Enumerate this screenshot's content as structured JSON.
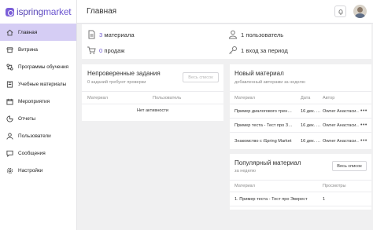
{
  "app": {
    "logo_prefix": "ispring",
    "logo_suffix": "market"
  },
  "header": {
    "title": "Главная"
  },
  "sidebar": {
    "items": [
      {
        "label": "Главная",
        "icon": "home-icon"
      },
      {
        "label": "Витрина",
        "icon": "storefront-icon"
      },
      {
        "label": "Программы обучения",
        "icon": "path-icon"
      },
      {
        "label": "Учебные материалы",
        "icon": "book-icon"
      },
      {
        "label": "Мероприятия",
        "icon": "calendar-icon"
      },
      {
        "label": "Отчеты",
        "icon": "report-icon"
      },
      {
        "label": "Пользователи",
        "icon": "users-icon"
      },
      {
        "label": "Сообщения",
        "icon": "message-icon"
      },
      {
        "label": "Настройки",
        "icon": "gear-icon"
      }
    ]
  },
  "stats": {
    "materials": {
      "num": "3",
      "text": "материала"
    },
    "sales": {
      "num": "0",
      "text": "продаж"
    },
    "users": {
      "text": "1 пользователь"
    },
    "logins": {
      "text": "1 вход за период"
    }
  },
  "unchecked": {
    "title": "Непроверенные задания",
    "subtitle": "0 заданий требуют проверки",
    "button": "Весь список",
    "columns": [
      "Материал",
      "Пользователь"
    ],
    "empty": "Нет активности"
  },
  "new_material": {
    "title": "Новый материал",
    "subtitle": "добавленный авторами за неделю",
    "columns": [
      "Материал",
      "Дата",
      "Автор"
    ],
    "rows": [
      {
        "material": "Пример диалогового трен…",
        "date": "16 дек. …",
        "author": "Owner Анастаси…",
        "more": "•••"
      },
      {
        "material": "Пример теста - Тест про З…",
        "date": "16 дек. …",
        "author": "Owner Анастаси…",
        "more": "•••"
      },
      {
        "material": "Знакомство с iSpring Market",
        "date": "16 дек. …",
        "author": "Owner Анастаси…",
        "more": "•••"
      }
    ]
  },
  "popular": {
    "title": "Популярный материал",
    "subtitle": "за неделю",
    "button": "Весь список",
    "columns": [
      "Материал",
      "Просмотры"
    ],
    "rows": [
      {
        "material": "1. Пример теста - Тест про Эверест",
        "views": "1"
      }
    ]
  },
  "colors": {
    "accent": "#6d57d0",
    "active_nav": "#d5cdf4",
    "background": "#f0f0f1"
  }
}
